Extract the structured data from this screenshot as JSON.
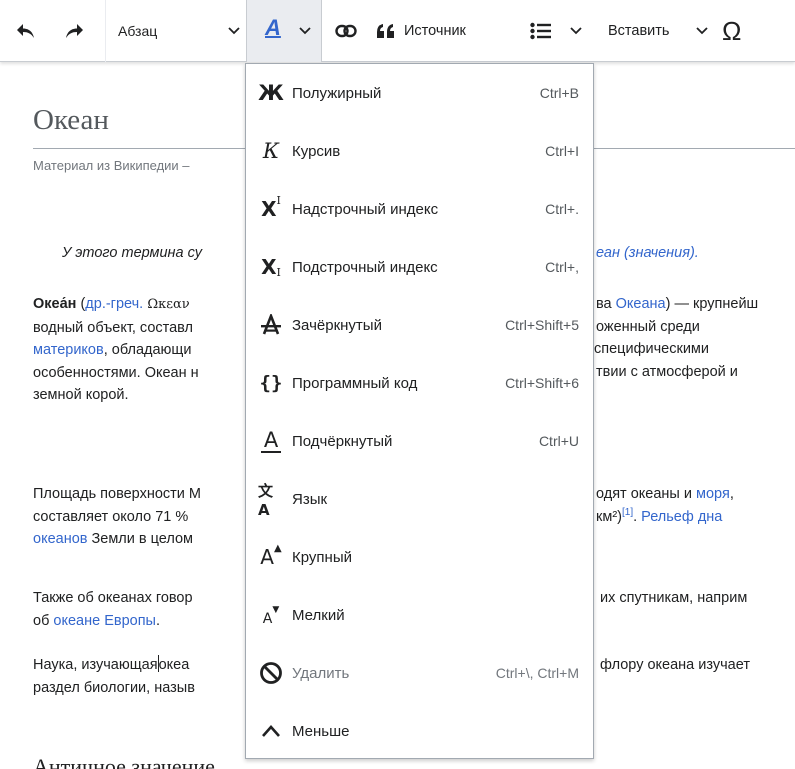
{
  "toolbar": {
    "paragraph_label": "Абзац",
    "format_letter": "A",
    "cite_label": "Источник",
    "insert_label": "Вставить",
    "special_char": "Ω"
  },
  "article": {
    "title": "Океан",
    "tagline": "Материал из Википедии –",
    "hatnote_text": "У этого термина су",
    "hatnote_link": "еан (значения).",
    "p1": {
      "l1_bold": "Океа́н",
      "l1_open": " (",
      "l1_link": "др.-греч.",
      "l1_greek": " Ωκεαν",
      "l1_right_pre": "ва ",
      "l1_right_link": "Океана",
      "l1_right_post": ") — крупнейш",
      "l2_left": "водный объект, составл",
      "l2_right": "оженный среди",
      "l3_left_link": "материков",
      "l3_left_post": ", обладающи",
      "l3_right": "специфическими",
      "l4_left": "особенностями. Океан н",
      "l4_right": "твии с атмосферой и",
      "l5_left": "земной корой."
    },
    "p2": {
      "l1_left": "Площадь поверхности М",
      "l1_right_pre": "одят океаны и ",
      "l1_right_link": "моря",
      "l1_right_post": ",",
      "l2_left": "составляет около 71 % ",
      "l2_right_pre": "км²)",
      "l2_ref": "[1]",
      "l2_right_mid": ". ",
      "l2_right_link": "Рельеф дна",
      "l3_left_link": "океанов",
      "l3_left_post": " Земли в целом"
    },
    "p3": {
      "l1_left": "Также об океанах говор",
      "l1_right": "их спутникам, наприм",
      "l2_pre": "об ",
      "l2_link": "океане Европы",
      "l2_post": "."
    },
    "p4": {
      "l1_left_a": "Наука, изучающая",
      "l1_left_b": "океа",
      "l1_right": "флору океана изучает",
      "l2_left": "раздел биологии, назыв"
    },
    "section_heading": "Античное значение"
  },
  "format_menu": {
    "items": [
      {
        "icon": "bold-icon",
        "glyph": "Ж",
        "label": "Полужирный",
        "shortcut": "Ctrl+B"
      },
      {
        "icon": "italic-icon",
        "glyph": "К",
        "label": "Курсив",
        "shortcut": "Ctrl+I"
      },
      {
        "icon": "superscript-icon",
        "glyph": "X",
        "label": "Надстрочный индекс",
        "shortcut": "Ctrl+."
      },
      {
        "icon": "subscript-icon",
        "glyph": "X",
        "label": "Подстрочный индекс",
        "shortcut": "Ctrl+,"
      },
      {
        "icon": "strikethrough-icon",
        "glyph": "A",
        "label": "Зачёркнутый",
        "shortcut": "Ctrl+Shift+5"
      },
      {
        "icon": "code-icon",
        "glyph": "{}",
        "label": "Программный код",
        "shortcut": "Ctrl+Shift+6"
      },
      {
        "icon": "underline-icon",
        "glyph": "A",
        "label": "Подчёркнутый",
        "shortcut": "Ctrl+U"
      },
      {
        "icon": "language-icon",
        "glyph": "文A",
        "label": "Язык",
        "shortcut": ""
      },
      {
        "icon": "big-text-icon",
        "glyph": "A",
        "label": "Крупный",
        "shortcut": ""
      },
      {
        "icon": "small-text-icon",
        "glyph": "A",
        "label": "Мелкий",
        "shortcut": ""
      },
      {
        "icon": "clear-format-icon",
        "glyph": "⃠",
        "label": "Удалить",
        "shortcut": "Ctrl+\\, Ctrl+M",
        "disabled": true
      },
      {
        "icon": "chevron-up-icon",
        "glyph": "^",
        "label": "Меньше",
        "shortcut": ""
      }
    ]
  },
  "colors": {
    "link": "#3366cc",
    "accent": "#36c",
    "text": "#202122",
    "muted": "#72777d"
  }
}
